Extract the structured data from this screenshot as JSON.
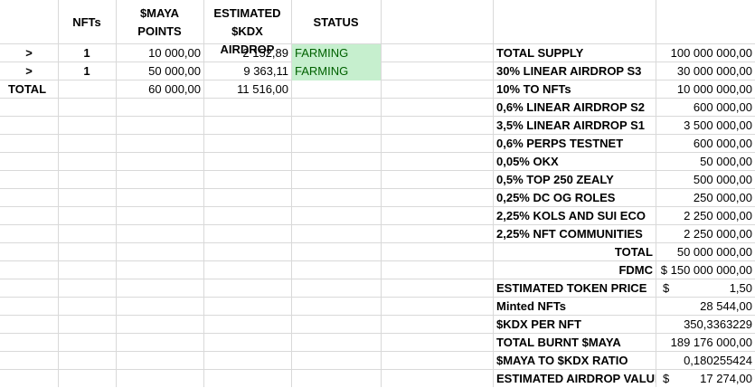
{
  "headers": {
    "nfts": "NFTs",
    "maya_points_1": "$MAYA",
    "maya_points_2": "POINTS",
    "estimated_1": "ESTIMATED",
    "estimated_2": "$KDX AIRDROP",
    "status": "STATUS"
  },
  "rows": [
    {
      "arrow": ">",
      "nfts": "1",
      "points": "10 000,00",
      "airdrop": "2 152,89",
      "status": "FARMING"
    },
    {
      "arrow": ">",
      "nfts": "1",
      "points": "50 000,00",
      "airdrop": "9 363,11",
      "status": "FARMING"
    }
  ],
  "total_row": {
    "label": "TOTAL",
    "points": "60 000,00",
    "airdrop": "11 516,00"
  },
  "stats": [
    {
      "label": "TOTAL SUPPLY",
      "value": "100 000 000,00"
    },
    {
      "label": "30% LINEAR AIRDROP S3",
      "value": "30 000 000,00"
    },
    {
      "label": "10% TO NFTs",
      "value": "10 000 000,00"
    },
    {
      "label": "0,6% LINEAR AIRDROP S2",
      "value": "600 000,00"
    },
    {
      "label": "3,5% LINEAR AIRDROP S1",
      "value": "3 500 000,00"
    },
    {
      "label": "0,6% PERPS TESTNET",
      "value": "600 000,00"
    },
    {
      "label": "0,05% OKX",
      "value": "50 000,00"
    },
    {
      "label": "0,5% TOP 250 ZEALY",
      "value": "500 000,00"
    },
    {
      "label": "0,25% DC OG ROLES",
      "value": "250 000,00"
    },
    {
      "label": "2,25% KOLS AND SUI ECO",
      "value": "2 250 000,00"
    },
    {
      "label": "2,25% NFT COMMUNITIES",
      "value": "2 250 000,00"
    }
  ],
  "stats_total": {
    "label": "TOTAL",
    "value": "50 000 000,00"
  },
  "fdmc": {
    "label": "FDMC",
    "value": "$ 150 000 000,00"
  },
  "extra": [
    {
      "label": "ESTIMATED TOKEN PRICE",
      "currency": "$",
      "value": "1,50"
    },
    {
      "label": "Minted NFTs",
      "currency": "",
      "value": "28 544,00"
    },
    {
      "label": "$KDX PER NFT",
      "currency": "",
      "value": "350,3363229"
    },
    {
      "label": "TOTAL BURNT $MAYA",
      "currency": "",
      "value": "189 176 000,00"
    },
    {
      "label": "$MAYA TO $KDX RATIO",
      "currency": "",
      "value": "0,180255424"
    },
    {
      "label": "ESTIMATED AIRDROP VALUE",
      "currency": "$",
      "value": "17 274,00"
    }
  ],
  "colors": {
    "farming_bg": "#c6efce",
    "farming_text": "#006100",
    "gridline": "#d9d9d9"
  }
}
